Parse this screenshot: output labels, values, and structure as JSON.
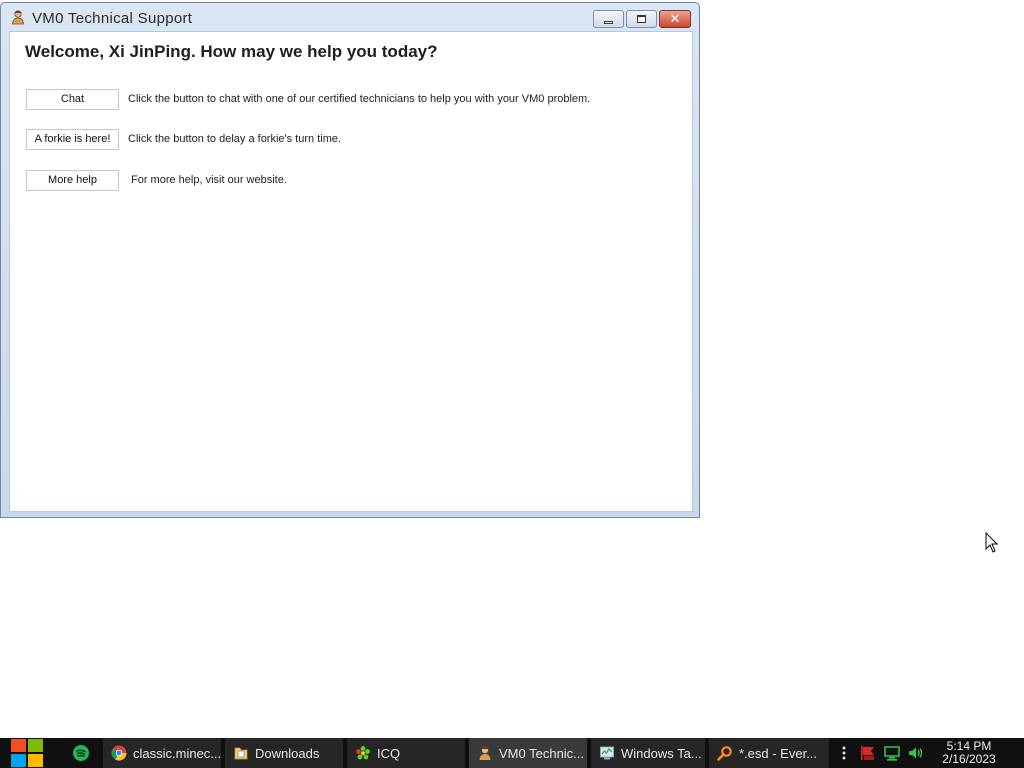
{
  "window": {
    "title": "VM0 Technical Support",
    "welcome": "Welcome, Xi JinPing. How may we help you today?",
    "rows": [
      {
        "button": "Chat",
        "description": "Click the button to chat with one of our certified technicians to help you with your VM0 problem."
      },
      {
        "button": "A forkie is here!",
        "description": "Click the button to delay a forkie's turn time."
      },
      {
        "button": "More help",
        "description": "For more help, visit our website."
      }
    ]
  },
  "taskbar": {
    "items": [
      {
        "label": "classic.minec...",
        "icon": "chrome-icon"
      },
      {
        "label": "Downloads",
        "icon": "folder-icon"
      },
      {
        "label": "ICQ",
        "icon": "icq-flower-icon"
      },
      {
        "label": "VM0 Technic...",
        "icon": "support-person-icon"
      },
      {
        "label": "Windows Ta...",
        "icon": "task-manager-icon"
      },
      {
        "label": "*.esd - Ever...",
        "icon": "search-magnifier-icon"
      }
    ],
    "clock": {
      "time": "5:14 PM",
      "date": "2/16/2023"
    }
  },
  "colors": {
    "taskbar_bg": "#101010",
    "close_button": "#c8472d",
    "window_frame": "#c9d8ec"
  }
}
